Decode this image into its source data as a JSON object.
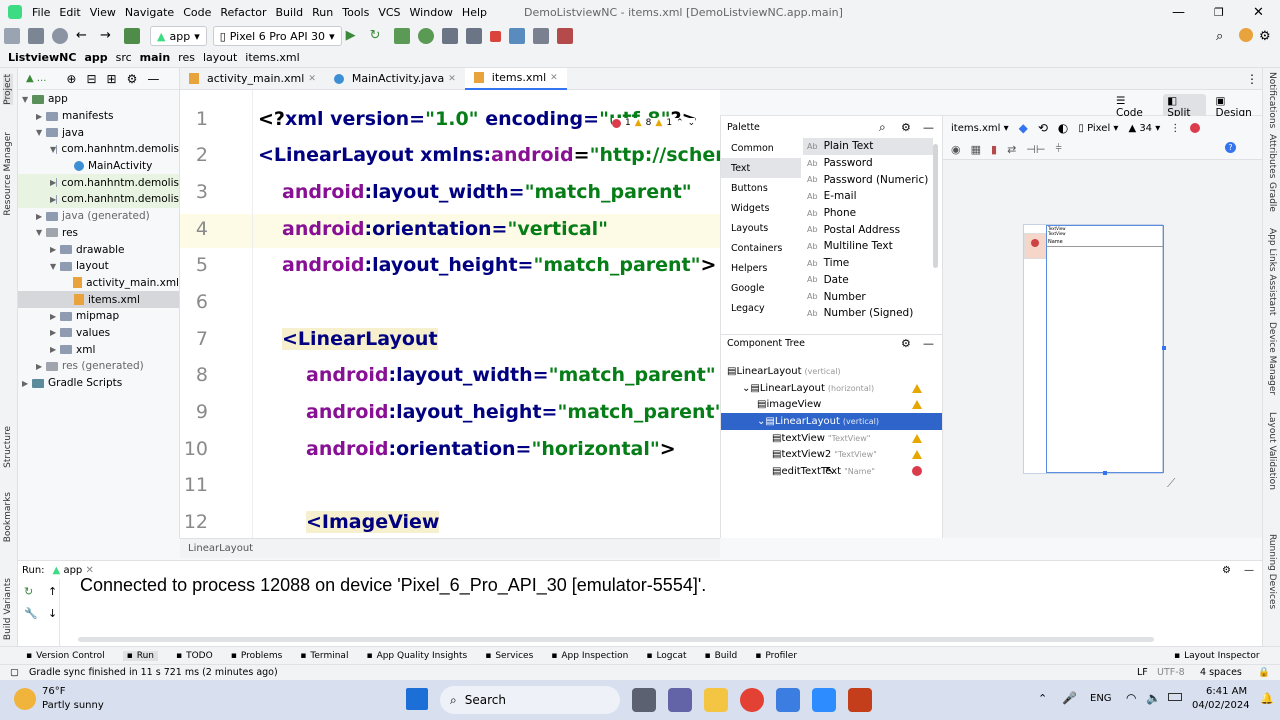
{
  "window": {
    "title": "DemoListviewNC - items.xml [DemoListviewNC.app.main]"
  },
  "menu": [
    "File",
    "Edit",
    "View",
    "Navigate",
    "Code",
    "Refactor",
    "Build",
    "Run",
    "Tools",
    "VCS",
    "Window",
    "Help"
  ],
  "toolbar": {
    "module": "app",
    "device": "Pixel 6 Pro API 30"
  },
  "breadcrumb": [
    "ListviewNC",
    "app",
    "src",
    "main",
    "res",
    "layout",
    "items.xml"
  ],
  "left_strip": [
    "Project",
    "Resource Manager",
    "Structure",
    "Bookmarks",
    "Build Variants"
  ],
  "right_strip": [
    "Notifications",
    "Attributes",
    "Gradle",
    "App Links Assistant",
    "Device Manager",
    "Layout Validation",
    "Running Devices"
  ],
  "project": {
    "view": "▲ ...",
    "tree": [
      {
        "label": "app",
        "depth": 0,
        "kind": "folder",
        "open": true
      },
      {
        "label": "manifests",
        "depth": 1,
        "kind": "folder"
      },
      {
        "label": "java",
        "depth": 1,
        "kind": "folder",
        "open": true
      },
      {
        "label": "com.hanhntm.demolis",
        "depth": 2,
        "kind": "folder",
        "open": true
      },
      {
        "label": "MainActivity",
        "depth": 3,
        "kind": "java"
      },
      {
        "label": "com.hanhntm.demolis",
        "depth": 2,
        "kind": "folder",
        "gen": true
      },
      {
        "label": "com.hanhntm.demolis",
        "depth": 2,
        "kind": "folder",
        "gen": true
      },
      {
        "label": "java (generated)",
        "depth": 1,
        "kind": "folder"
      },
      {
        "label": "res",
        "depth": 1,
        "kind": "res",
        "open": true
      },
      {
        "label": "drawable",
        "depth": 2,
        "kind": "folder"
      },
      {
        "label": "layout",
        "depth": 2,
        "kind": "folder",
        "open": true
      },
      {
        "label": "activity_main.xml",
        "depth": 3,
        "kind": "xml"
      },
      {
        "label": "items.xml",
        "depth": 3,
        "kind": "xml",
        "selected": true
      },
      {
        "label": "mipmap",
        "depth": 2,
        "kind": "folder"
      },
      {
        "label": "values",
        "depth": 2,
        "kind": "folder"
      },
      {
        "label": "xml",
        "depth": 2,
        "kind": "folder"
      },
      {
        "label": "res (generated)",
        "depth": 1,
        "kind": "res"
      },
      {
        "label": "Gradle Scripts",
        "depth": 0,
        "kind": "gradle"
      }
    ]
  },
  "tabs": [
    "activity_main.xml",
    "MainActivity.java",
    "items.xml"
  ],
  "modes": {
    "code": "Code",
    "split": "Split",
    "design": "Design"
  },
  "editor": {
    "inspections": {
      "errors": "1",
      "warnings": "8",
      "weak": "1"
    },
    "lines": [
      {
        "n": "1",
        "parts": [
          [
            "plain",
            "<?"
          ],
          [
            "tag",
            "xml version="
          ],
          [
            "val",
            "\"1.0\""
          ],
          [
            "tag",
            " encoding="
          ],
          [
            "val",
            "\"utf-8\""
          ],
          [
            "plain",
            "?>"
          ]
        ]
      },
      {
        "n": "2",
        "parts": [
          [
            "tag",
            "<LinearLayout "
          ],
          [
            "tag",
            "xmlns:"
          ],
          [
            "ns",
            "android"
          ],
          [
            "plain",
            "="
          ],
          [
            "val",
            "\"http://schemas."
          ]
        ]
      },
      {
        "n": "3",
        "parts": [
          [
            "ns",
            "android"
          ],
          [
            "tag",
            ":layout_width="
          ],
          [
            "val",
            "\"match_parent\""
          ]
        ]
      },
      {
        "n": "4",
        "parts": [
          [
            "ns",
            "android"
          ],
          [
            "tag",
            ":orientation="
          ],
          [
            "val",
            "\"vertical\""
          ]
        ]
      },
      {
        "n": "5",
        "parts": [
          [
            "ns",
            "android"
          ],
          [
            "tag",
            ":layout_height="
          ],
          [
            "val",
            "\"match_parent\""
          ],
          [
            "plain",
            ">"
          ]
        ]
      },
      {
        "n": "6",
        "parts": []
      },
      {
        "n": "7",
        "parts": [
          [
            "tag",
            "<LinearLayout"
          ]
        ]
      },
      {
        "n": "8",
        "parts": [
          [
            "ns",
            "android"
          ],
          [
            "tag",
            ":layout_width="
          ],
          [
            "val",
            "\"match_parent\""
          ]
        ]
      },
      {
        "n": "9",
        "parts": [
          [
            "ns",
            "android"
          ],
          [
            "tag",
            ":layout_height="
          ],
          [
            "val",
            "\"match_parent\""
          ]
        ]
      },
      {
        "n": "10",
        "parts": [
          [
            "ns",
            "android"
          ],
          [
            "tag",
            ":orientation="
          ],
          [
            "val",
            "\"horizontal\""
          ],
          [
            "plain",
            ">"
          ]
        ]
      },
      {
        "n": "11",
        "parts": []
      },
      {
        "n": "12",
        "parts": [
          [
            "tag",
            "<ImageView"
          ]
        ]
      }
    ],
    "status": "LinearLayout"
  },
  "palette": {
    "title": "Palette",
    "categories": [
      "Common",
      "Text",
      "Buttons",
      "Widgets",
      "Layouts",
      "Containers",
      "Helpers",
      "Google",
      "Legacy"
    ],
    "selected_category": "Text",
    "items": [
      "Plain Text",
      "Password",
      "Password (Numeric)",
      "E-mail",
      "Phone",
      "Postal Address",
      "Multiline Text",
      "Time",
      "Date",
      "Number",
      "Number (Signed)"
    ],
    "item_prefix": "Ab"
  },
  "component_tree": {
    "title": "Component Tree",
    "nodes": [
      {
        "label": "LinearLayout",
        "hint": "(vertical)",
        "depth": 0,
        "status": ""
      },
      {
        "label": "LinearLayout",
        "hint": "(horizontal)",
        "depth": 1,
        "status": "warn"
      },
      {
        "label": "imageView",
        "hint": "",
        "depth": 2,
        "status": "warn"
      },
      {
        "label": "LinearLayout",
        "hint": "(vertical)",
        "depth": 2,
        "status": "",
        "selected": true
      },
      {
        "label": "textView",
        "hint": "\"TextView\"",
        "depth": 3,
        "status": "warn"
      },
      {
        "label": "textView2",
        "hint": "\"TextView\"",
        "depth": 3,
        "status": "warn"
      },
      {
        "label": "editTextText",
        "hint": "\"Name\"",
        "depth": 3,
        "status": "err"
      }
    ]
  },
  "design": {
    "file": "items.xml",
    "device": "Pixel",
    "api": "34",
    "preview_text": [
      "TextView",
      "TextView",
      "Name"
    ]
  },
  "run": {
    "label": "Run:",
    "config": "app",
    "output": "Connected to process 12088 on device 'Pixel_6_Pro_API_30 [emulator-5554]'."
  },
  "bottom_tabs": [
    "Version Control",
    "Run",
    "TODO",
    "Problems",
    "Terminal",
    "App Quality Insights",
    "Services",
    "App Inspection",
    "Logcat",
    "Build",
    "Profiler",
    "Layout Inspector"
  ],
  "status": {
    "message": "Gradle sync finished in 11 s 721 ms (2 minutes ago)",
    "line_sep": "LF",
    "encoding": "UTF-8",
    "indent": "4 spaces"
  },
  "taskbar": {
    "temp": "76°F",
    "weather": "Partly sunny",
    "search": "Search",
    "lang": "ENG",
    "time": "6:41 AM",
    "date": "04/02/2024"
  },
  "colors": {
    "accent": "#3574f0",
    "selection": "#2f65ca",
    "warning": "#e6a700",
    "error": "#db3b4b"
  }
}
